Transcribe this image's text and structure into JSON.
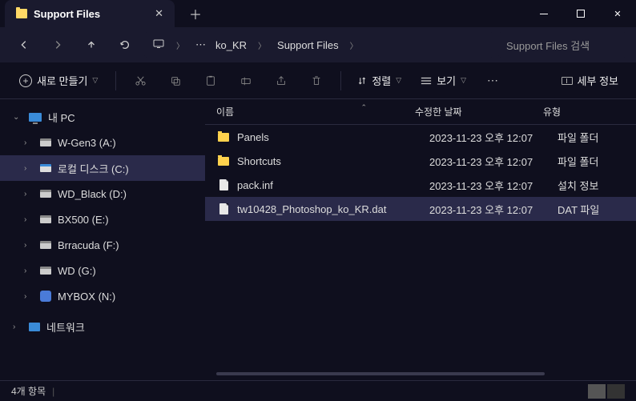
{
  "titlebar": {
    "tab_title": "Support Files"
  },
  "breadcrumb": {
    "dots": "⋯",
    "items": [
      "ko_KR",
      "Support Files"
    ]
  },
  "search": {
    "placeholder": "Support Files 검색"
  },
  "toolbar": {
    "new_label": "새로 만들기",
    "sort_label": "정렬",
    "view_label": "보기",
    "detail_label": "세부 정보"
  },
  "sidebar": {
    "pc_label": "내 PC",
    "drives": [
      {
        "label": "W-Gen3 (A:)",
        "selected": false
      },
      {
        "label": "로컬 디스크 (C:)",
        "selected": true
      },
      {
        "label": "WD_Black (D:)",
        "selected": false
      },
      {
        "label": "BX500 (E:)",
        "selected": false
      },
      {
        "label": "Brracuda (F:)",
        "selected": false
      },
      {
        "label": "WD (G:)",
        "selected": false
      }
    ],
    "mybox_label": "MYBOX (N:)",
    "network_label": "네트워크"
  },
  "columns": {
    "name": "이름",
    "date": "수정한 날짜",
    "type": "유형"
  },
  "files": [
    {
      "name": "Panels",
      "date": "2023-11-23 오후 12:07",
      "type": "파일 폴더",
      "icon": "folder",
      "selected": false
    },
    {
      "name": "Shortcuts",
      "date": "2023-11-23 오후 12:07",
      "type": "파일 폴더",
      "icon": "folder",
      "selected": false
    },
    {
      "name": "pack.inf",
      "date": "2023-11-23 오후 12:07",
      "type": "설치 정보",
      "icon": "file",
      "selected": false
    },
    {
      "name": "tw10428_Photoshop_ko_KR.dat",
      "date": "2023-11-23 오후 12:07",
      "type": "DAT 파일",
      "icon": "file",
      "selected": true
    }
  ],
  "status": {
    "count_label": "4개 항목"
  }
}
